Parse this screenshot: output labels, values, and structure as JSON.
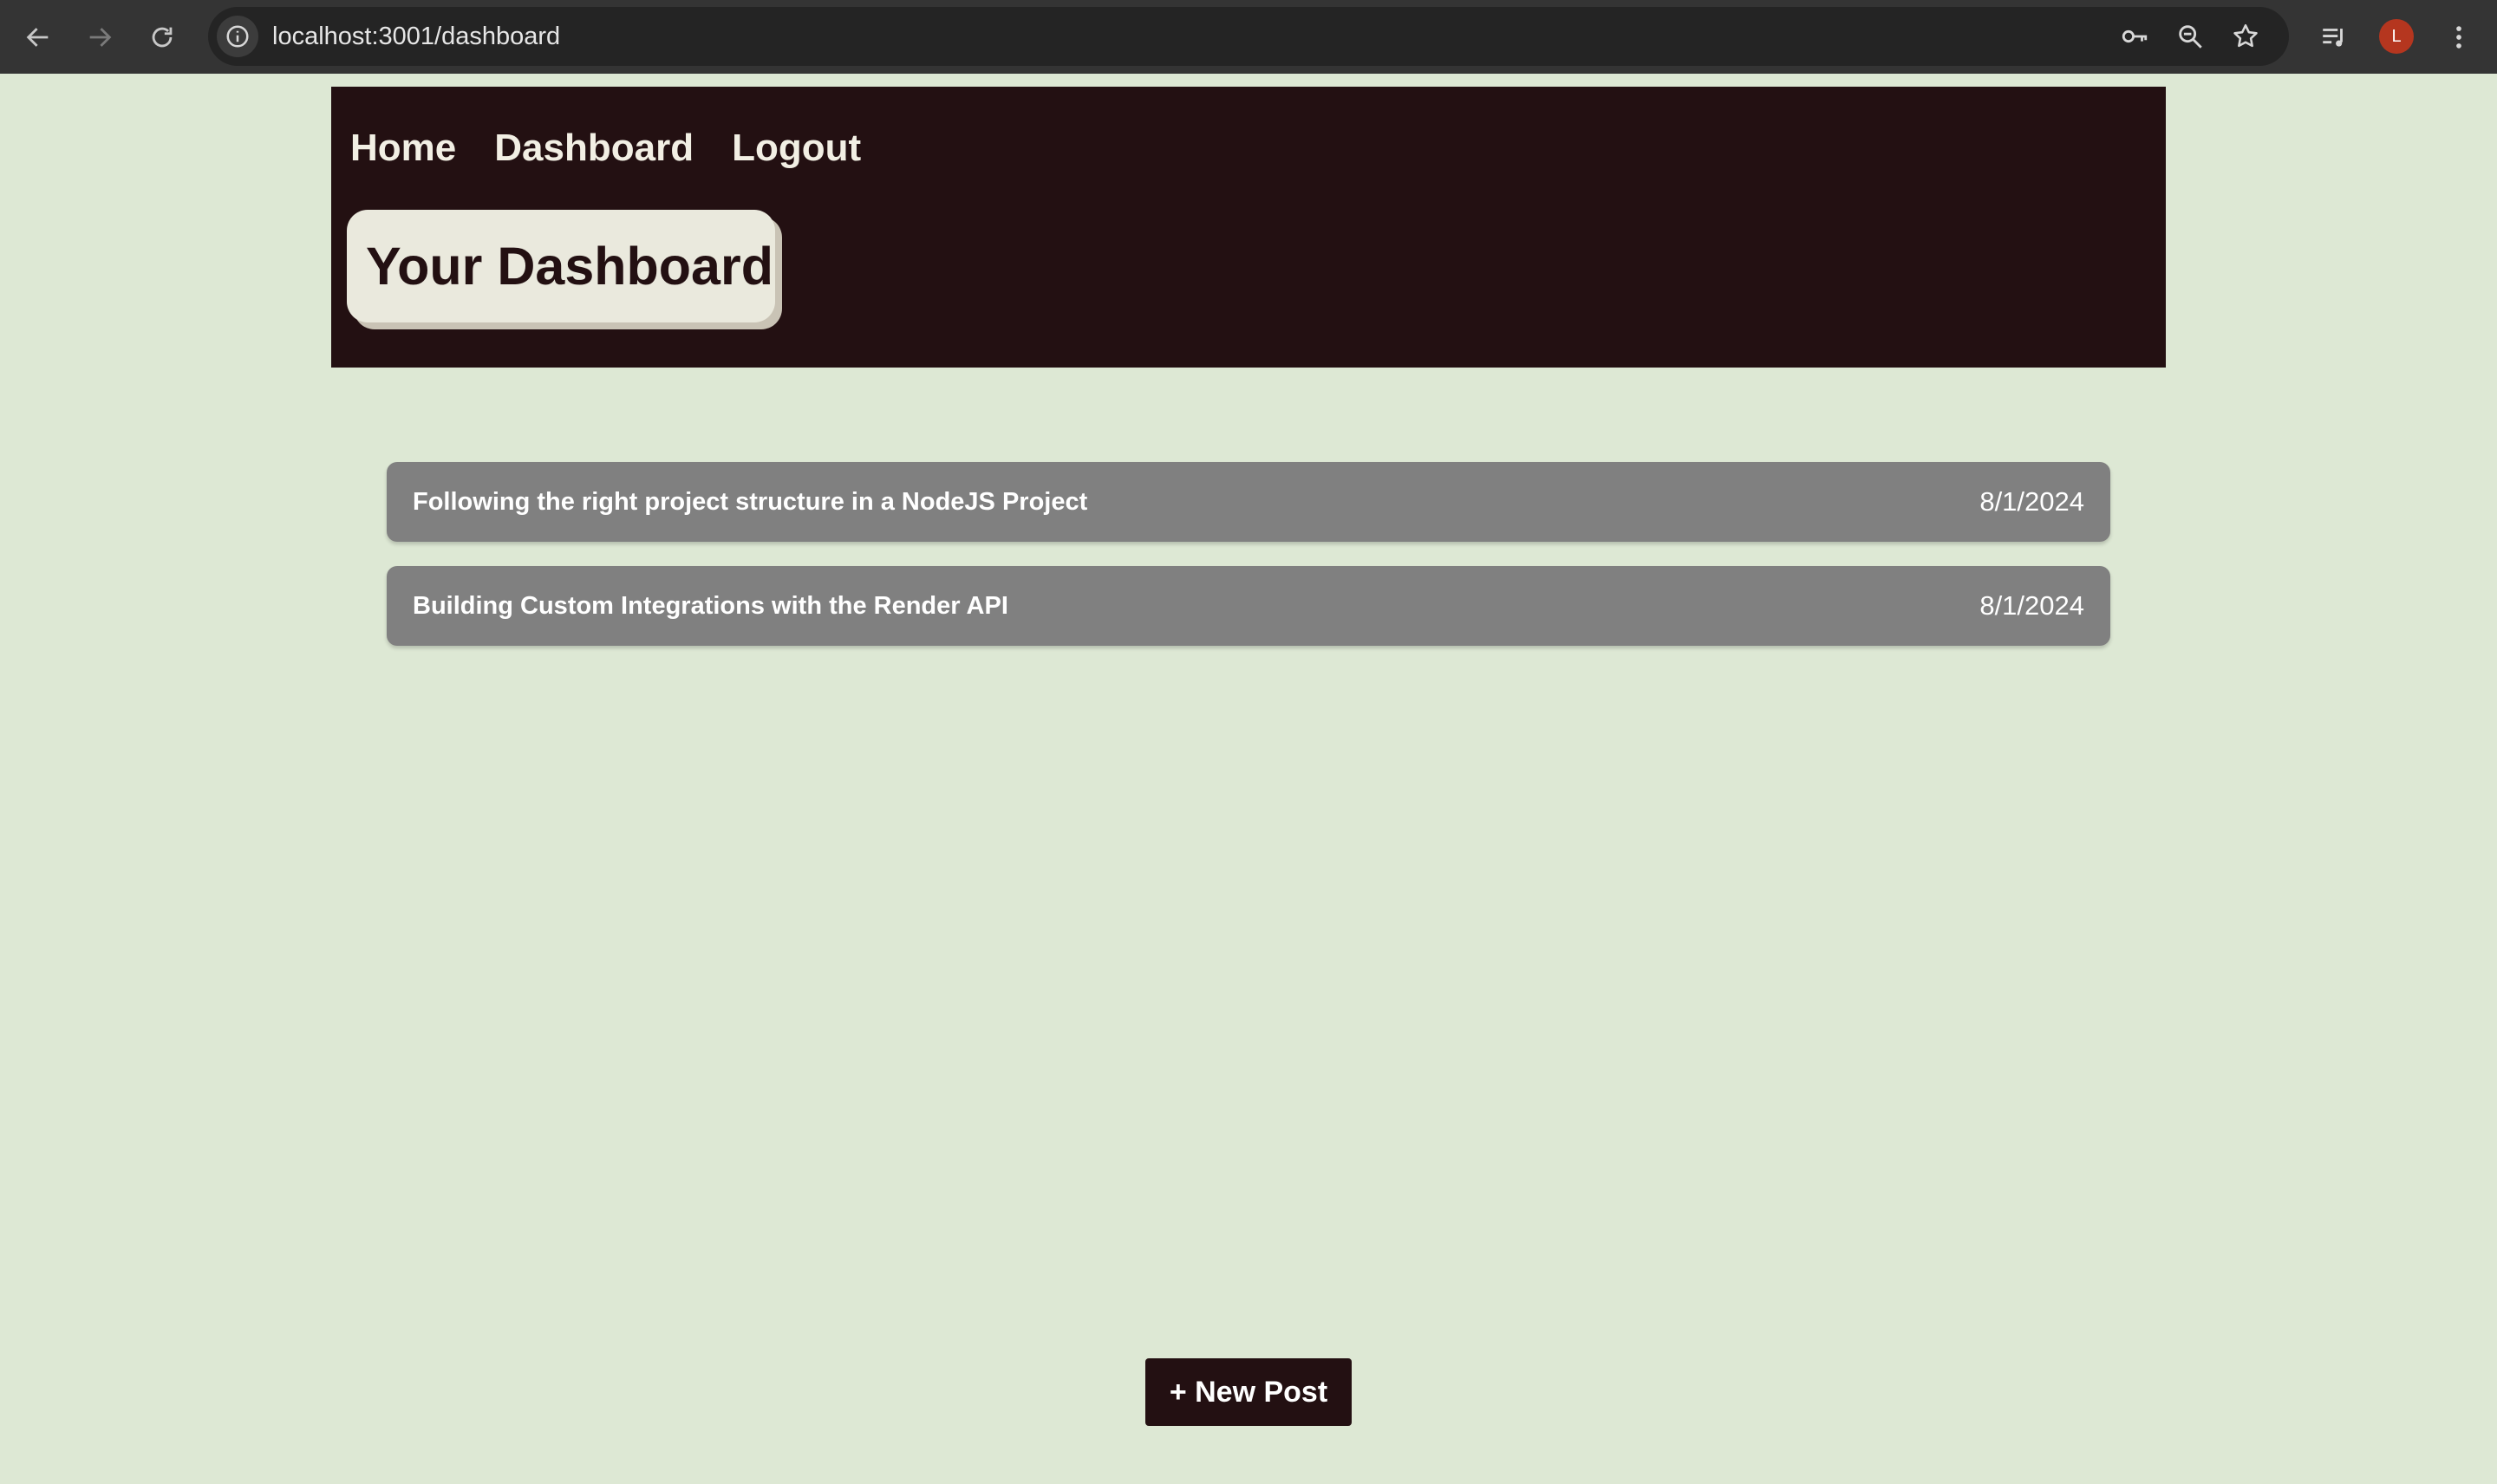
{
  "browser": {
    "url": "localhost:3001/dashboard",
    "profile_initial": "L",
    "icons": [
      "back-icon",
      "forward-icon",
      "reload-icon",
      "site-info-icon",
      "password-key-icon",
      "zoom-icon",
      "bookmark-star-icon",
      "media-controls-icon",
      "more-menu-icon"
    ]
  },
  "nav": {
    "home": "Home",
    "dashboard": "Dashboard",
    "logout": "Logout"
  },
  "page": {
    "title": "Your Dashboard"
  },
  "posts": [
    {
      "title": "Following the right project structure in a NodeJS Project",
      "date": "8/1/2024"
    },
    {
      "title": "Building Custom Integrations with the Render API",
      "date": "8/1/2024"
    }
  ],
  "actions": {
    "new_post": "+ New Post"
  },
  "colors": {
    "page_background": "#dde8d4",
    "header_background": "#231012",
    "post_background": "#808080",
    "title_card_background": "#eae9dd"
  }
}
